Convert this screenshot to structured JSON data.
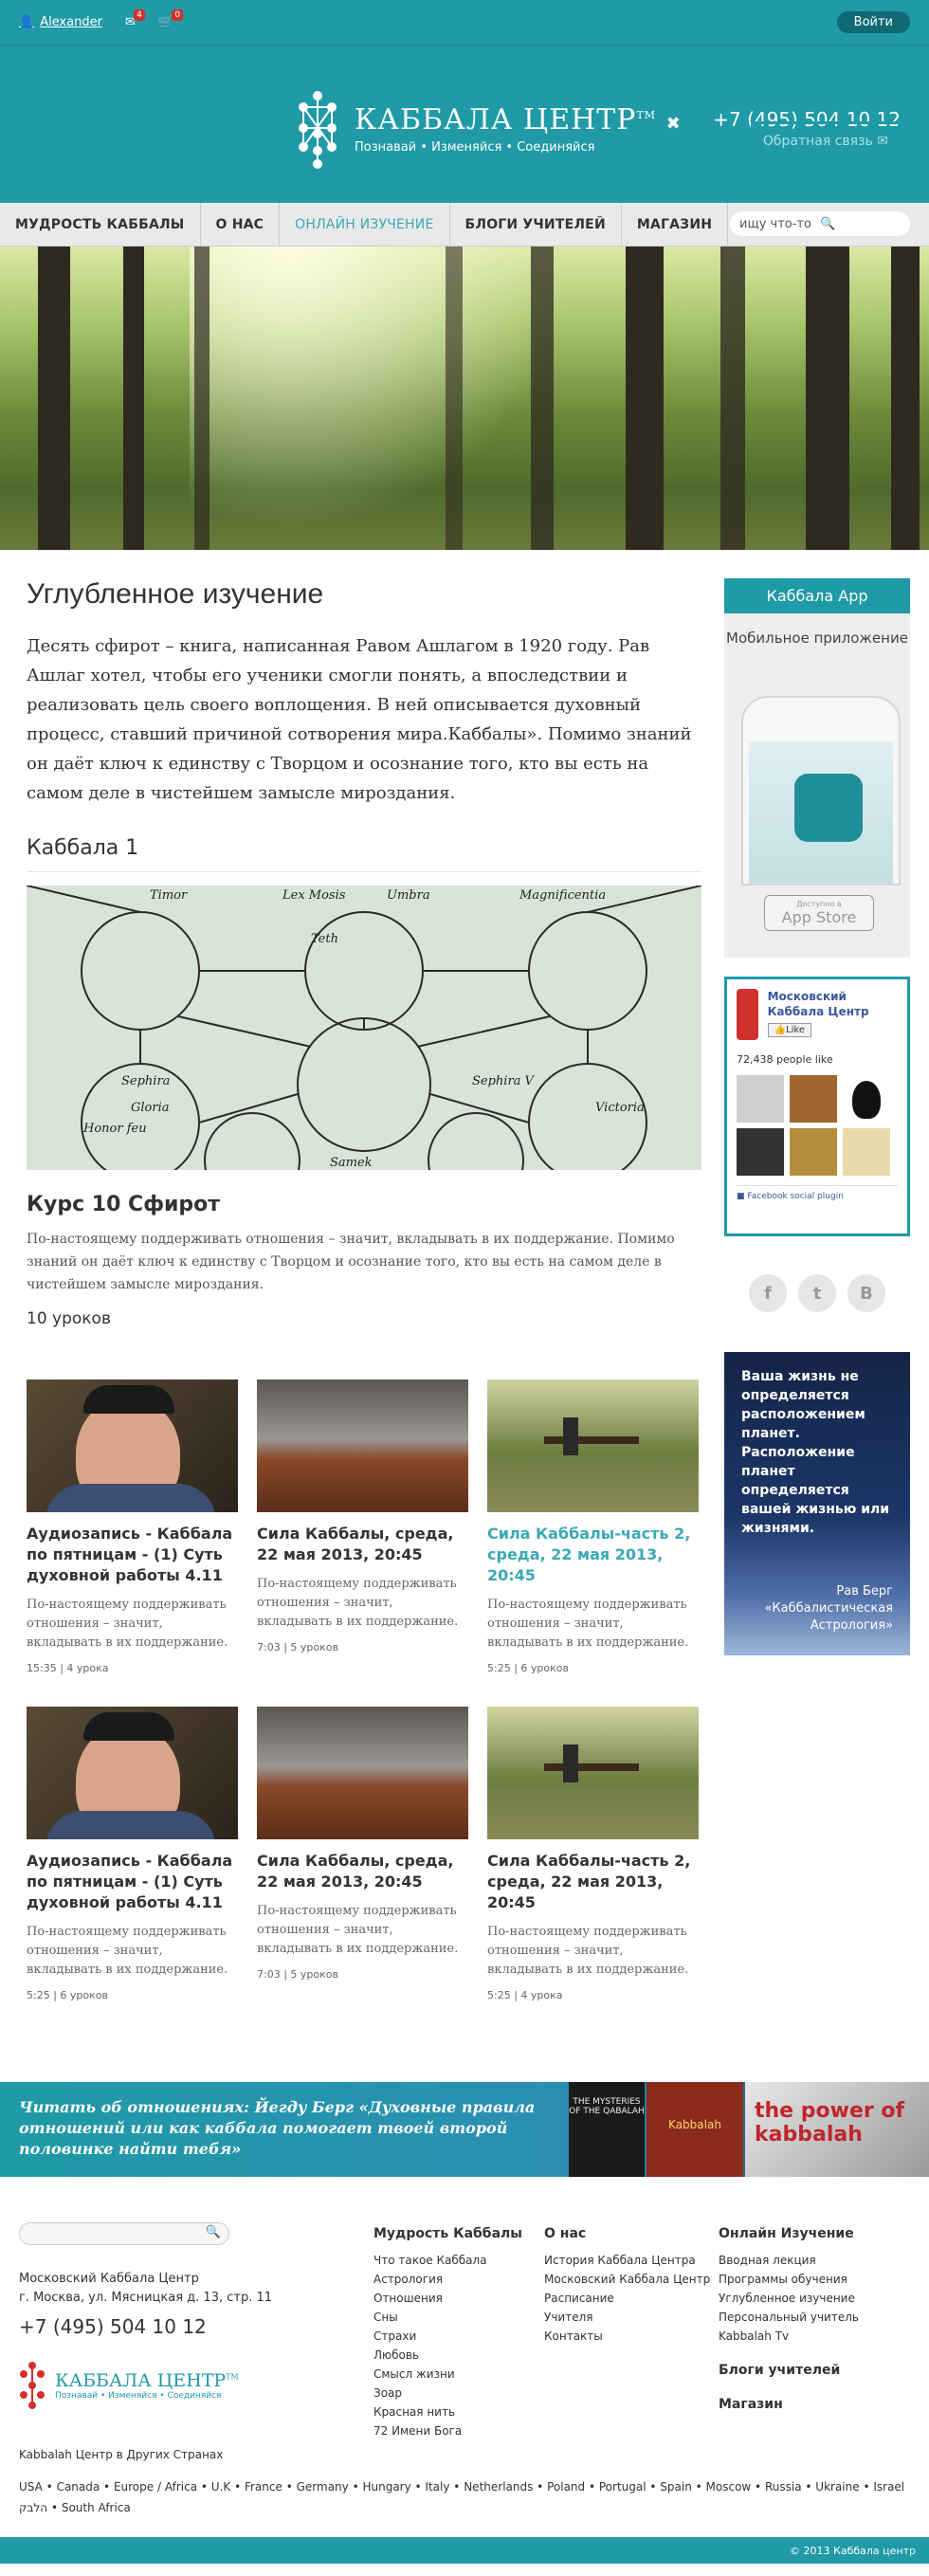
{
  "topbar": {
    "user": "Alexander",
    "mail_count": "4",
    "cart_count": "0",
    "login": "Войти"
  },
  "header": {
    "logo_name": "КАББАЛА ЦЕНТР",
    "logo_tm": "TM",
    "logo_tagline": "Познавай • Изменяйся • Соединяйся",
    "phone": "+7 (495) 504 10 12",
    "feedback": "Обратная связь"
  },
  "nav": {
    "items": [
      "МУДРОСТЬ КАББАЛЫ",
      "О НАС",
      "ОНЛАЙН ИЗУЧЕНИЕ",
      "БЛОГИ УЧИТЕЛЕЙ",
      "МАГАЗИН"
    ],
    "search_placeholder": "ищу что-то"
  },
  "main": {
    "title": "Углубленное изучение",
    "intro": "Десять сфирот – книга, написанная Равом Ашлагом в 1920 году. Рав Ашлаг хотел, чтобы его ученики смогли понять, а впоследствии и реализовать цель своего воплощения. В ней описывается духовный процесс, ставший причиной сотворения мира.Каббалы». Помимо знаний он даёт ключ к единству с Творцом и осознание того, кто вы есть на самом деле в чистейшем замысле мироздания.",
    "section": "Каббала 1",
    "course_title": "Курс 10 Сфирот",
    "course_desc": "По-настоящему поддерживать отношения – значит, вкладывать в их поддержание. Помимо знаний он даёт ключ к единству с Творцом и осознание того, кто вы есть на самом деле в чистейшем замысле мироздания.",
    "lessons": "10 уроков",
    "diagram_words": [
      "Timor",
      "Lex Mosis",
      "Umbra",
      "Magnificentia",
      "Teth",
      "Sephira",
      "Gloria",
      "Victoria",
      "Honor feu",
      "Samek",
      "Sephira V"
    ],
    "cards": [
      {
        "title": "Аудиозапись - Каббала по пятницам - (1) Суть духовной работы 4.11",
        "desc": "По-настоящему поддерживать отношения – значит, вкладывать в их поддержание.",
        "meta": "15:35 | 4 урока",
        "image": "man-portrait"
      },
      {
        "title": "Сила Каббалы, среда, 22 мая 2013, 20:45",
        "desc": "По-настоящему поддерживать отношения – значит, вкладывать в их поддержание.",
        "meta": "7:03 | 5 уроков",
        "image": "desert-landscape"
      },
      {
        "title": "Сила Каббалы-часть 2, среда, 22 мая 2013, 20:45",
        "desc": "По-настоящему поддерживать отношения – значит, вкладывать в их поддержание.",
        "meta": "5:25 | 6 уроков",
        "image": "park-bench",
        "highlight": true
      },
      {
        "title": "Аудиозапись - Каббала по пятницам - (1) Суть духовной работы 4.11",
        "desc": "По-настоящему поддерживать отношения – значит, вкладывать в их поддержание.",
        "meta": "5:25 | 6 уроков",
        "image": "man-portrait"
      },
      {
        "title": "Сила Каббалы, среда, 22 мая 2013, 20:45",
        "desc": "По-настоящему поддерживать отношения – значит, вкладывать в их поддержание.",
        "meta": "7:03 | 5 уроков",
        "image": "desert-landscape"
      },
      {
        "title": "Сила Каббалы-часть 2, среда, 22 мая 2013, 20:45",
        "desc": "По-настоящему поддерживать отношения – значит, вкладывать в их поддержание.",
        "meta": "5:25 | 4 урока",
        "image": "park-bench"
      }
    ]
  },
  "sidebar": {
    "app_title": "Каббала App",
    "app_text": "Мобильное приложение",
    "appstore_small": "Доступно в",
    "appstore": "App Store",
    "fb_name": "Московский Каббала Центр",
    "fb_like": "Like",
    "fb_count": "72,438 people like",
    "fb_plugin": "Facebook social plugin",
    "social": [
      "f",
      "t",
      "B"
    ],
    "quote": "Ваша жизнь не определяется расположением планет. Расположение планет определяется вашей жизнью или жизнями.",
    "quote_author": "Рав Берг «Каббалистическая Астрология»"
  },
  "banner": {
    "text": "Читать об отношениях: Йегду Берг «Духовные правила отношений или как каббала помогает твоей второй половинке найти тебя»",
    "book1": "THE MYSTERIES OF THE QABALAH",
    "book2": "Kabbalah",
    "book3": "the power of kabbalah"
  },
  "footer": {
    "org": "Московский Каббала Центр",
    "address": "г. Москва, ул. Мясницкая д. 13, стр. 11",
    "phone": "+7 (495) 504 10 12",
    "logo_name": "КАББАЛА ЦЕНТР",
    "logo_tm": "TM",
    "logo_tagline": "Познавай • Изменяйся • Соединяйся",
    "col1": {
      "title": "Мудрость Каббалы",
      "links": [
        "Что такое Каббала",
        "Астрология",
        "Отношения",
        "Сны",
        "Страхи",
        "Любовь",
        "Смысл жизни",
        "Зоар",
        "Красная нить",
        "72 Имени Бога"
      ]
    },
    "col2": {
      "title": "О нас",
      "links": [
        "История Каббала Центра",
        "Московский Каббала Центр",
        "Расписание",
        "Учителя",
        "Контакты"
      ]
    },
    "col3": {
      "title": "Онлайн Изучение",
      "links": [
        "Вводная лекция",
        "Программы обучения",
        "Углубленное изучение",
        "Персональный учитель",
        "Kabbalah Tv"
      ],
      "extra1": "Блоги учителей",
      "extra2": "Магазин"
    },
    "countries_label": "Kabbalah Центр в Других Странах",
    "countries": [
      "USA",
      "Canada",
      "Europe / Africa",
      "U.K",
      "France",
      "Germany",
      "Hungary",
      "Italy",
      "Netherlands",
      "Poland",
      "Portugal",
      "Spain",
      "Moscow",
      "Russia",
      "Ukraine",
      "Israel הלבק",
      "South Africa"
    ],
    "copyright": "© 2013 Каббала центр"
  }
}
